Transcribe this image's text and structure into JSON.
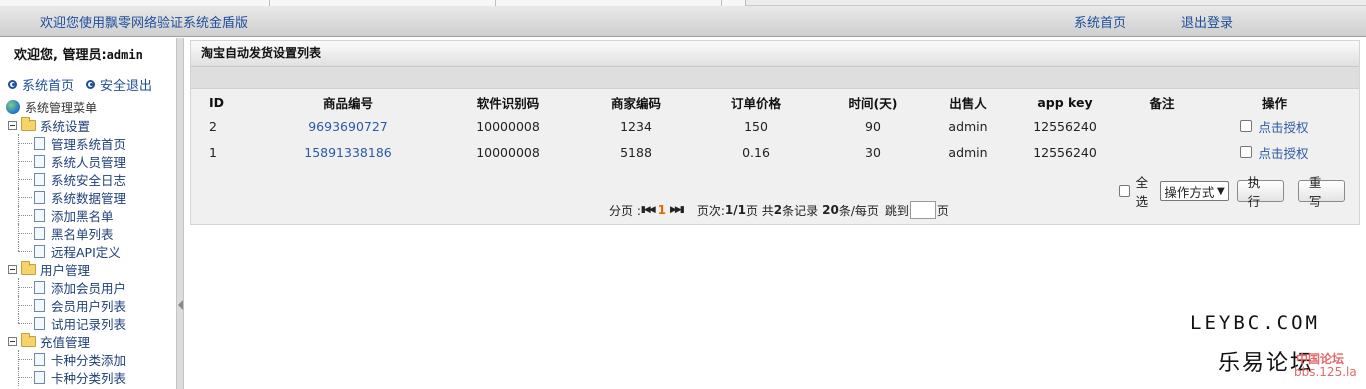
{
  "header": {
    "welcome": "欢迎您使用飘零网络验证系统金盾版",
    "home_link": "系统首页",
    "logout_link": "退出登录"
  },
  "sidebar": {
    "greeting": "欢迎您, 管理员:",
    "username": "admin",
    "quick_home": "系统首页",
    "quick_logout": "安全退出",
    "tree_root": "系统管理菜单",
    "groups": [
      {
        "label": "系统设置",
        "items": [
          "管理系统首页",
          "系统人员管理",
          "系统安全日志",
          "系统数据管理",
          "添加黑名单",
          "黑名单列表",
          "远程API定义"
        ]
      },
      {
        "label": "用户管理",
        "items": [
          "添加会员用户",
          "会员用户列表",
          "试用记录列表"
        ]
      },
      {
        "label": "充值管理",
        "items": [
          "卡种分类添加",
          "卡种分类列表"
        ]
      }
    ]
  },
  "panel": {
    "title": "淘宝自动发货设置列表",
    "columns": [
      "ID",
      "商品编号",
      "软件识别码",
      "商家编码",
      "订单价格",
      "时间(天)",
      "出售人",
      "app key",
      "备注",
      "操作"
    ],
    "rows": [
      {
        "id": "2",
        "product_no": "9693690727",
        "software_code": "10000008",
        "merchant_code": "1234",
        "price": "150",
        "days": "90",
        "seller": "admin",
        "app_key": "12556240",
        "note": "",
        "action": "点击授权"
      },
      {
        "id": "1",
        "product_no": "15891338186",
        "software_code": "10000008",
        "merchant_code": "5188",
        "price": "0.16",
        "days": "30",
        "seller": "admin",
        "app_key": "12556240",
        "note": "",
        "action": "点击授权"
      }
    ],
    "batch": {
      "select_all": "全选",
      "operation_select": "操作方式",
      "execute_button": "执 行",
      "reset_button": "重 写"
    },
    "pager": {
      "label": "分页 :",
      "current_page": "1",
      "page_text_prefix": "页次:",
      "page_text_value": "1/1",
      "page_text_suffix": "页 共",
      "total_records": "2",
      "records_text": "条记录",
      "per_page": "20",
      "per_page_text": "条/每页",
      "jump_text": "跳到",
      "page_unit": "页"
    }
  },
  "watermark": {
    "line1": "LEYBC.COM",
    "line2": "乐易论坛",
    "line3": "中国论坛",
    "line4": "bbs.125.la"
  }
}
